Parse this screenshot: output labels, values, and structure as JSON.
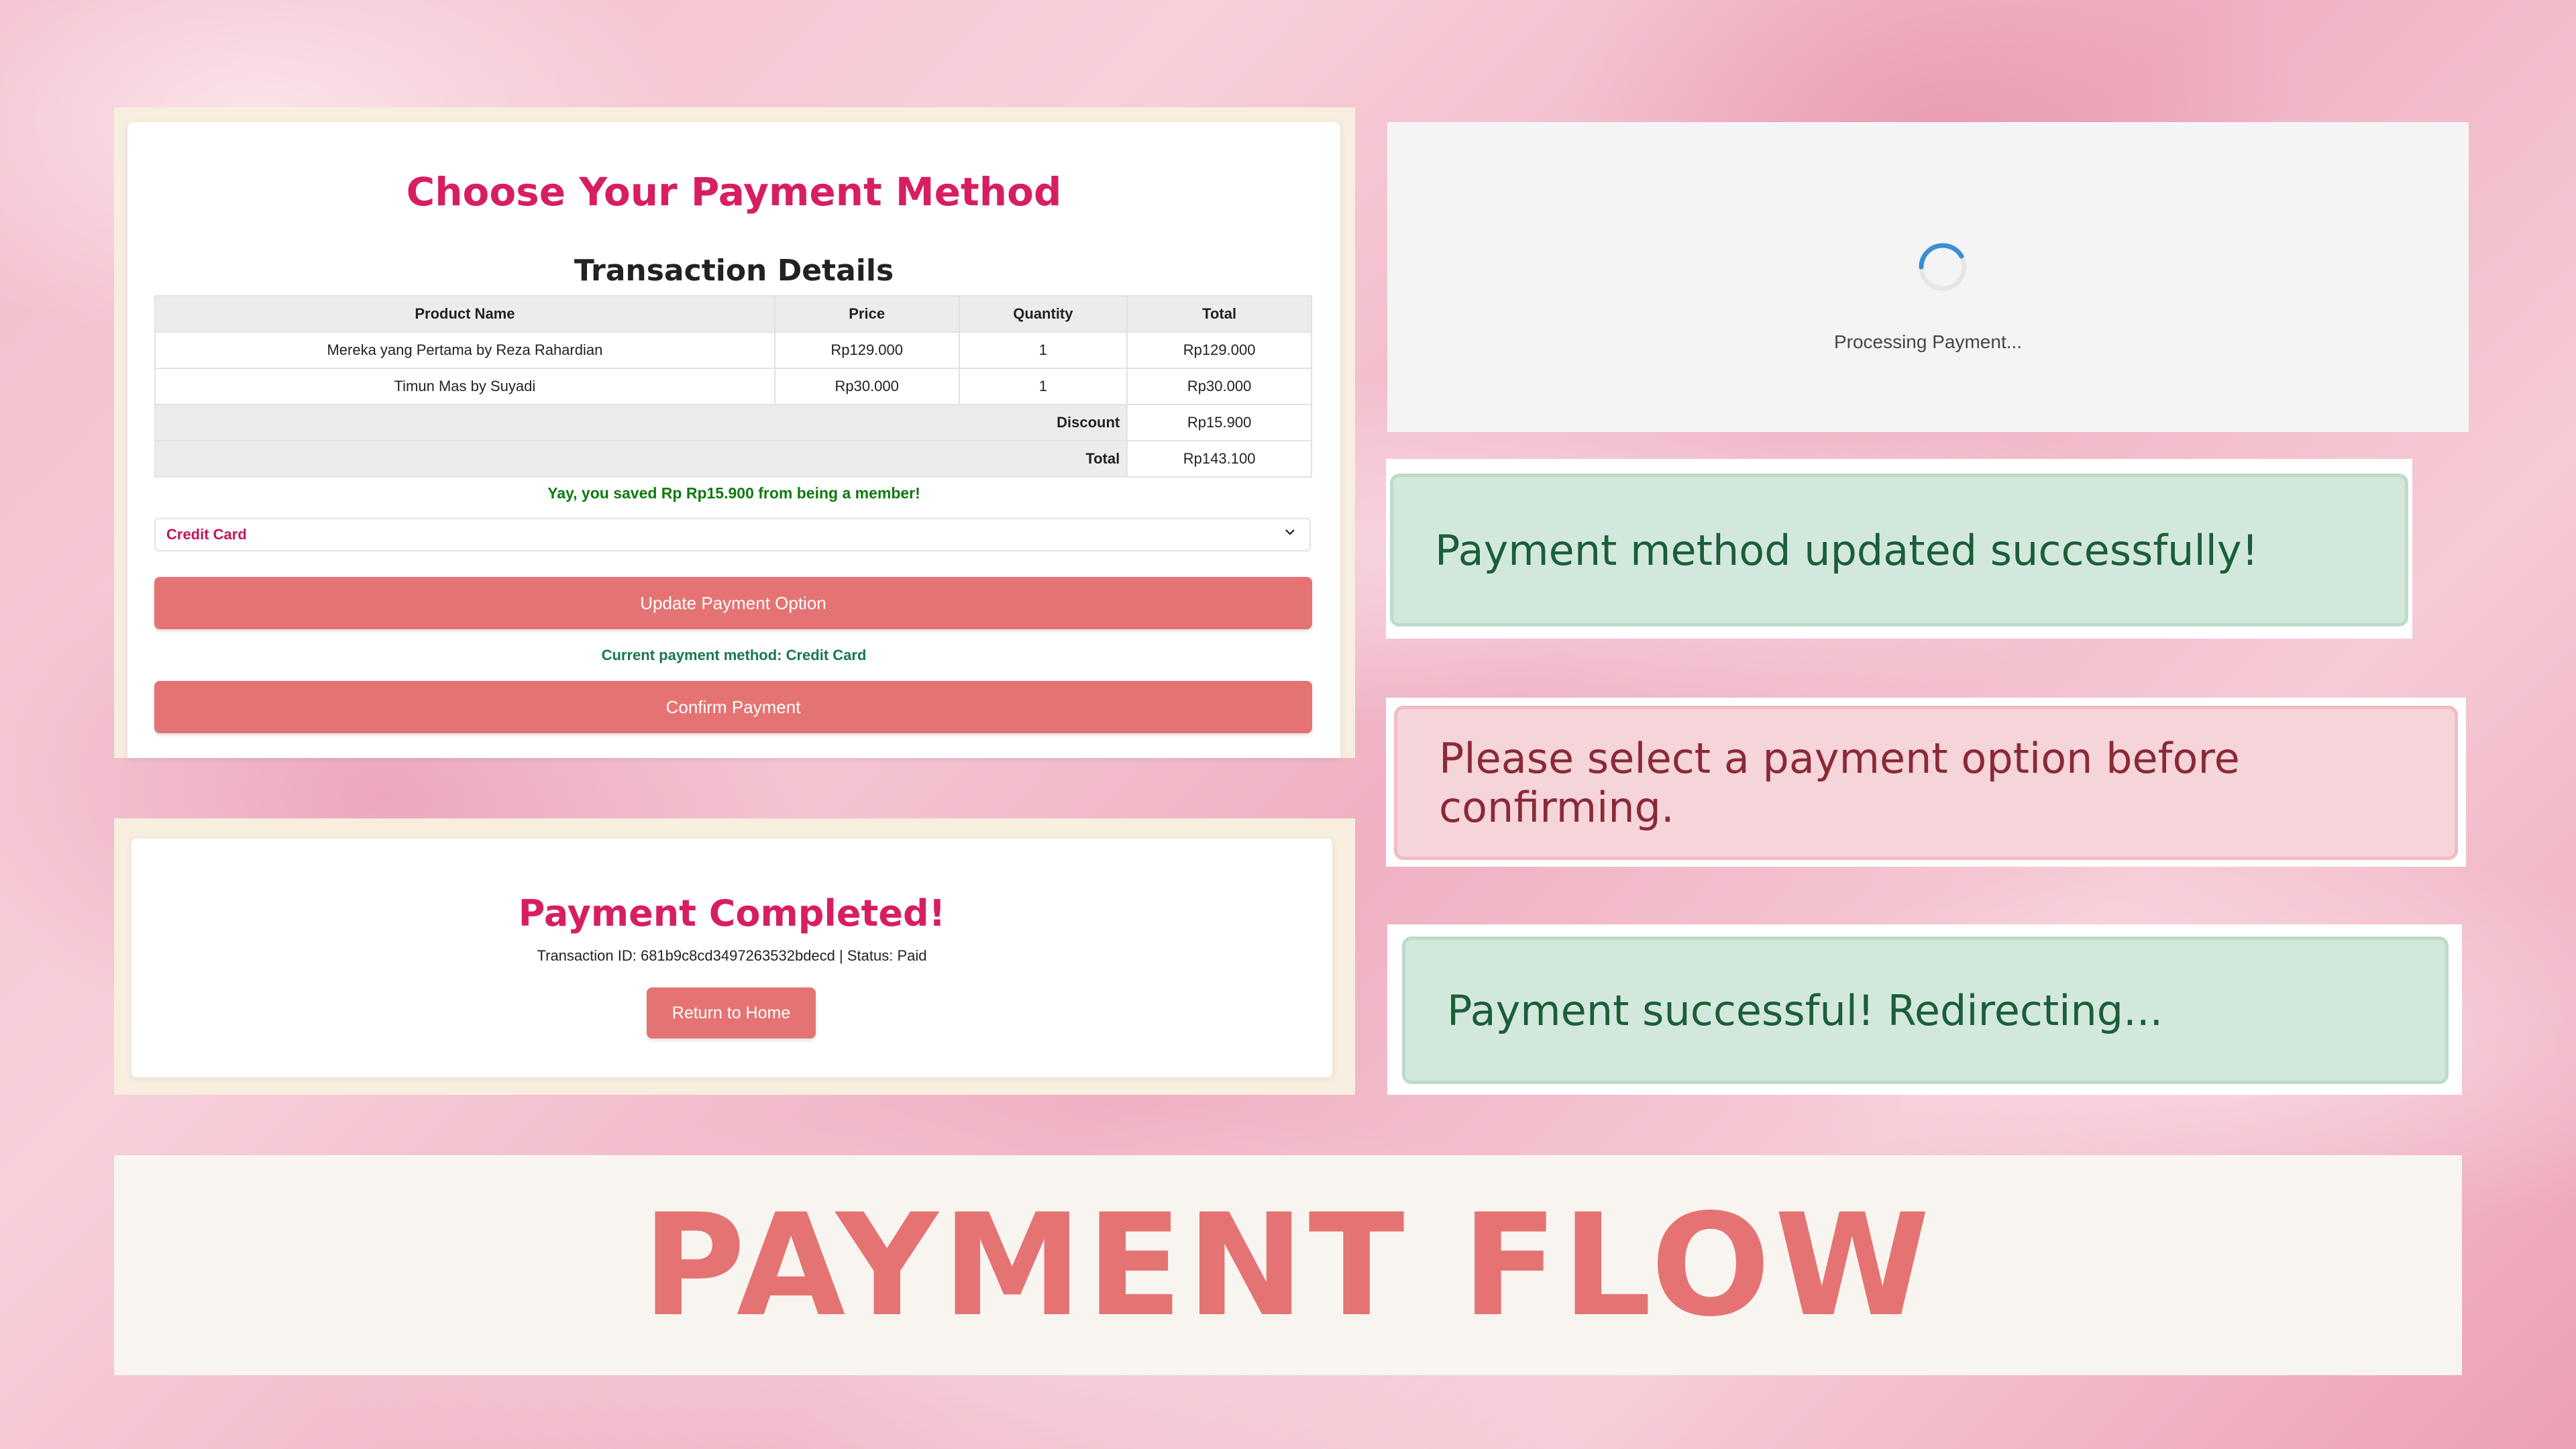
{
  "payment_method_page": {
    "title": "Choose Your Payment Method",
    "section_title": "Transaction Details",
    "table": {
      "headers": [
        "Product Name",
        "Price",
        "Quantity",
        "Total"
      ],
      "rows": [
        [
          "Mereka yang Pertama by Reza Rahardian",
          "Rp129.000",
          "1",
          "Rp129.000"
        ],
        [
          "Timun Mas by Suyadi",
          "Rp30.000",
          "1",
          "Rp30.000"
        ]
      ],
      "discount_label": "Discount",
      "discount_value": "Rp15.900",
      "total_label": "Total",
      "total_value": "Rp143.100"
    },
    "savings_message": "Yay, you saved Rp Rp15.900 from being a member!",
    "payment_select": {
      "selected": "Credit Card"
    },
    "update_button": "Update Payment Option",
    "current_method": "Current payment method: Credit Card",
    "confirm_button": "Confirm Payment"
  },
  "payment_completed": {
    "title": "Payment Completed!",
    "info": "Transaction ID: 681b9c8cd3497263532bdecd | Status: Paid",
    "home_button": "Return to Home"
  },
  "processing": {
    "text": "Processing Payment...",
    "spinner_icon": "loading-spinner-icon"
  },
  "alerts": {
    "method_updated": "Payment method updated successfully!",
    "select_option": "Please select a payment option before confirming.",
    "payment_success": "Payment successful! Redirecting..."
  },
  "banner": {
    "text": "PAYMENT FLOW"
  },
  "colors": {
    "accent_pink": "#d81e62",
    "button": "#e57373",
    "success_text": "#1b5e3a",
    "danger_text": "#8a2a36",
    "spinner": "#3a8fd6"
  }
}
